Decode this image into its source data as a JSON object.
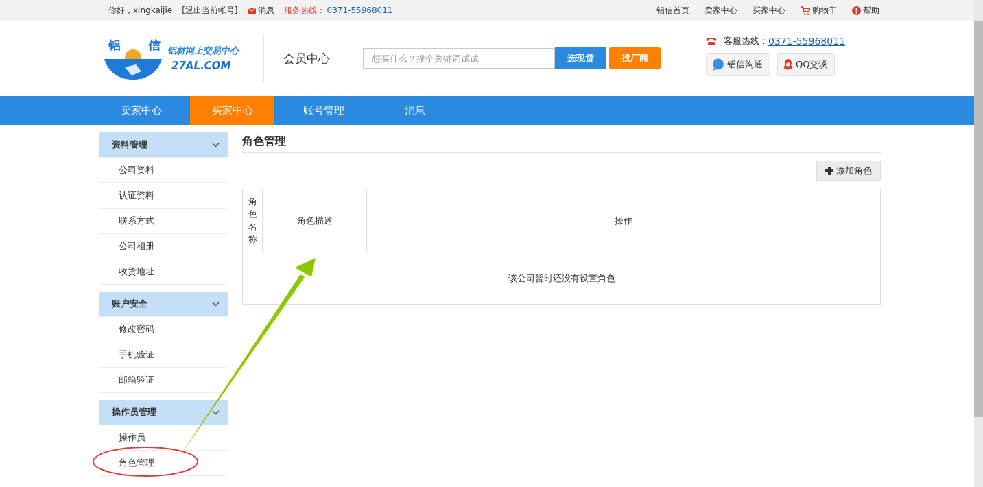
{
  "top_bar": {
    "greeting": "你好，xingkaijie",
    "logout": "[退出当前帐号]",
    "messages": "消息",
    "hotline_label": "服务热线：",
    "hotline_number": "0371-55968011",
    "links": [
      {
        "label": "铝信首页",
        "kind": "plain"
      },
      {
        "label": "卖家中心",
        "kind": "plain"
      },
      {
        "label": "买家中心",
        "kind": "plain"
      },
      {
        "label": "购物车",
        "kind": "cart"
      },
      {
        "label": "帮助",
        "kind": "help"
      }
    ]
  },
  "header": {
    "logo": {
      "mark_left": "铝",
      "mark_right": "信",
      "slogan": "铝材网上交易中心",
      "domain": "27AL.COM"
    },
    "section_title": "会员中心",
    "search": {
      "placeholder": "想买什么？搜个关键词试试"
    },
    "search_buttons": [
      {
        "label": "选现货",
        "kind": "primary"
      },
      {
        "label": "找厂商",
        "kind": "accent"
      }
    ],
    "service_label": "客服热线：",
    "service_number": "0371-55968011",
    "chat_buttons": [
      {
        "label": "铝信沟通",
        "kind": "al"
      },
      {
        "label": "QQ交谈",
        "kind": "qq"
      }
    ]
  },
  "nav": [
    {
      "label": "卖家中心",
      "selected": false
    },
    {
      "label": "买家中心",
      "selected": true
    },
    {
      "label": "账号管理",
      "selected": false
    },
    {
      "label": "消息",
      "selected": false
    }
  ],
  "sidebar": [
    {
      "title": "资料管理",
      "items": [
        "公司资料",
        "认证资料",
        "联系方式",
        "公司相册",
        "收货地址"
      ]
    },
    {
      "title": "账户安全",
      "items": [
        "修改密码",
        "手机验证",
        "邮箱验证"
      ]
    },
    {
      "title": "操作员管理",
      "items": [
        "操作员",
        "角色管理"
      ]
    }
  ],
  "content": {
    "title": "角色管理",
    "add_button": "添加角色",
    "table": {
      "columns": [
        "角色名称",
        "角色描述",
        "操作"
      ],
      "empty_message": "该公司暂时还没有设置角色"
    }
  }
}
